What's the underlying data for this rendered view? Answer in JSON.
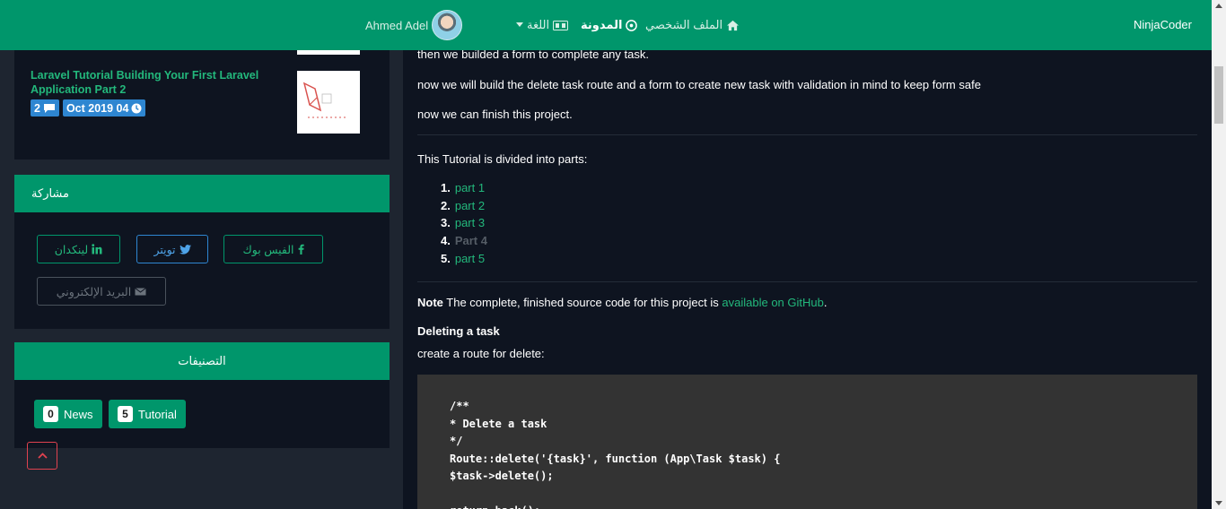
{
  "navbar": {
    "brand": "NinjaCoder",
    "profile_label": "الملف الشخصي",
    "blog_label": "المدونة",
    "language_label": "اللغة",
    "user_name": "Ahmed Adel",
    "background_color": "#00966b"
  },
  "sidebar": {
    "recent_post": {
      "title": "Laravel Tutorial Building Your First Laravel Application Part 2",
      "comments_count": "2",
      "date": "Oct 2019 04"
    },
    "share": {
      "heading": "مشاركة",
      "facebook_label": "الفيس بوك",
      "twitter_label": "تويتر",
      "linkedin_label": "لينكدان",
      "email_label": "البريد الإلكتروني"
    },
    "categories": {
      "heading": "التصنيفات",
      "items": [
        {
          "name": "Tutorial",
          "count": "5"
        },
        {
          "name": "News",
          "count": "0"
        }
      ]
    }
  },
  "article": {
    "line_top": "then we builded a form to complete any task.",
    "line_delete": "now we will build the delete task route and a form to create new task with validation in mind to keep form safe",
    "line_finish": "now we can finish this project.",
    "parts_intro": "This Tutorial is divided into parts:",
    "parts": [
      {
        "num": "1.",
        "label": "part 1"
      },
      {
        "num": "2.",
        "label": "part 2"
      },
      {
        "num": "3.",
        "label": "part 3"
      },
      {
        "num": "4.",
        "label": "Part 4"
      },
      {
        "num": "5.",
        "label": "part 5"
      }
    ],
    "note_label": "Note",
    "note_text": "The complete, finished source code for this project is",
    "note_link": "available on GitHub",
    "note_end": ".",
    "section_title": "Deleting a task",
    "section_sub": "create a route for delete:",
    "code": "/**\n* Delete a task\n*/\nRoute::delete('{task}', function (App\\Task $task) {\n$task->delete();\n\nreturn back();"
  },
  "colors": {
    "accent": "#00966b",
    "link": "#23b87c",
    "badge_blue": "#2e86d1",
    "twitter": "#2e86d1",
    "facebook_border": "#00966b",
    "back_to_top": "#e0424f"
  }
}
